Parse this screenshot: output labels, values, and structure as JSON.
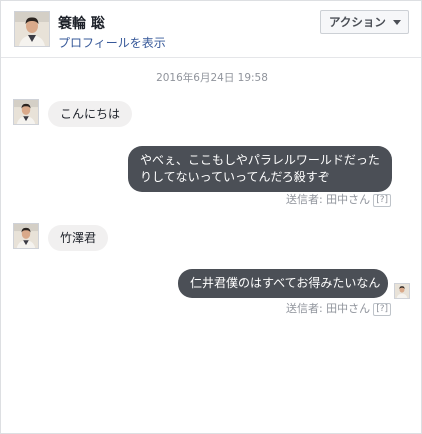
{
  "header": {
    "name": "簑輪 聡",
    "profile_link": "プロフィールを表示",
    "action_label": "アクション"
  },
  "timestamp": "2016年6月24日 19:58",
  "messages": [
    {
      "direction": "in",
      "text": "こんにちは"
    },
    {
      "direction": "out",
      "lines": [
        "やべぇ、ここもしやパラレルワールドだった",
        "りしてないっていってんだろ殺すぞ"
      ],
      "sender": "送信者: 田中さん",
      "help": "[?]"
    },
    {
      "direction": "in",
      "text": "竹澤君"
    },
    {
      "direction": "out",
      "lines": [
        "仁井君僕のはすべてお得みたいなん"
      ],
      "sender": "送信者: 田中さん",
      "help": "[?]"
    }
  ],
  "colors": {
    "outgoing_bubble": "#4b4f56",
    "incoming_bubble": "#f1f0f0",
    "link": "#365899"
  },
  "icons": {
    "avatar": "person-photo-icon",
    "dropdown": "caret-down-icon"
  }
}
